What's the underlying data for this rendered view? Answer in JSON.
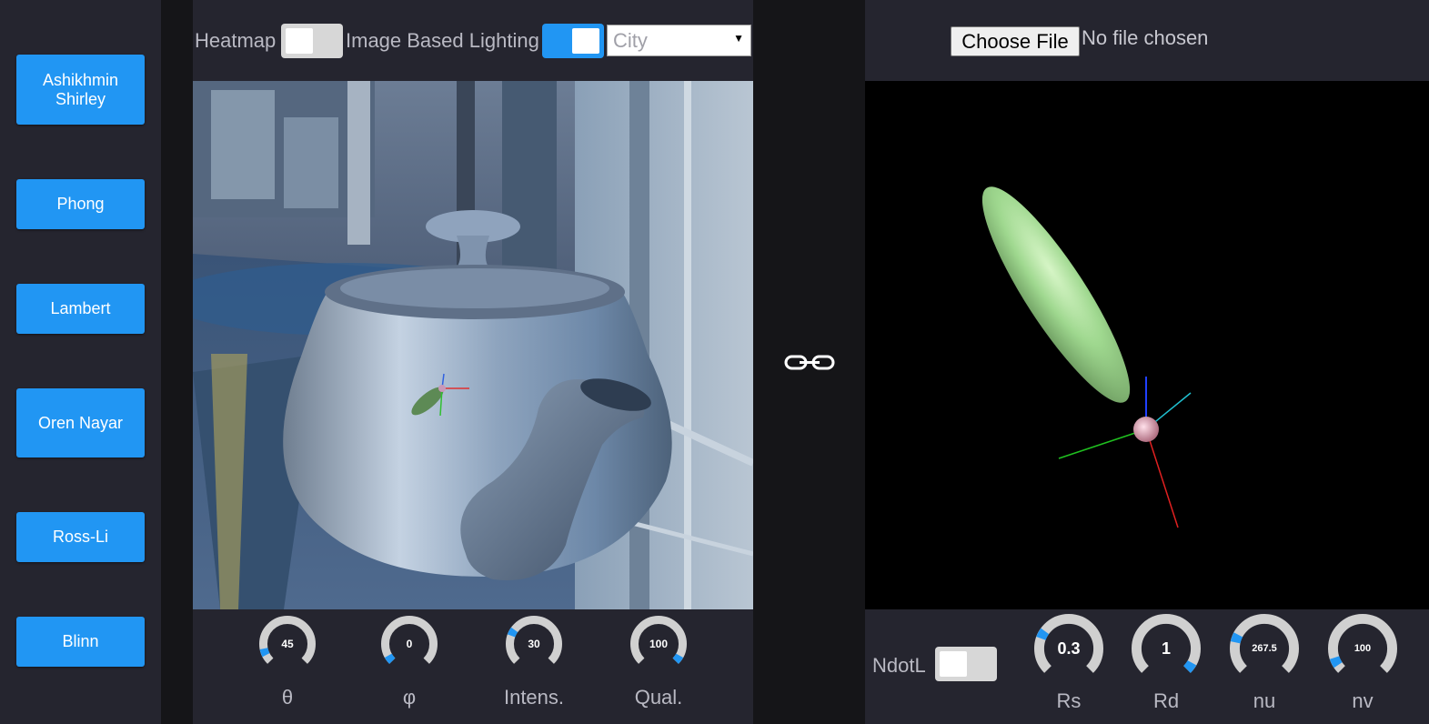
{
  "sidebar": {
    "buttons": [
      {
        "label": "Ashikhmin Shirley"
      },
      {
        "label": "Phong"
      },
      {
        "label": "Lambert"
      },
      {
        "label": "Oren Nayar"
      },
      {
        "label": "Ross-Li"
      },
      {
        "label": "Blinn"
      }
    ]
  },
  "toolbar": {
    "heatmap_label": "Heatmap",
    "heatmap_on": false,
    "ibl_label": "Image Based Lighting",
    "ibl_on": true,
    "environment": {
      "selected": "City"
    }
  },
  "left_controls": [
    {
      "value": "45",
      "label": "θ",
      "fraction": 0.125
    },
    {
      "value": "0",
      "label": "φ",
      "fraction": 0.0
    },
    {
      "value": "30",
      "label": "Intens.",
      "fraction": 0.3
    },
    {
      "value": "100",
      "label": "Qual.",
      "fraction": 1.0
    }
  ],
  "right_controls": {
    "ndotl_label": "NdotL",
    "ndotl_on": false,
    "dials": [
      {
        "value": "0.3",
        "label": "Rs",
        "fraction": 0.3
      },
      {
        "value": "1",
        "label": "Rd",
        "fraction": 1.0
      },
      {
        "value": "267.5",
        "label": "nu",
        "fraction": 0.27
      },
      {
        "value": "100",
        "label": "nv",
        "fraction": 0.1
      }
    ]
  },
  "file_input": {
    "button_label": "Choose File",
    "status": "No file chosen"
  },
  "colors": {
    "accent": "#2196f3",
    "panel": "#25252f",
    "gap": "#151518",
    "lobe": "#9fd88f"
  }
}
